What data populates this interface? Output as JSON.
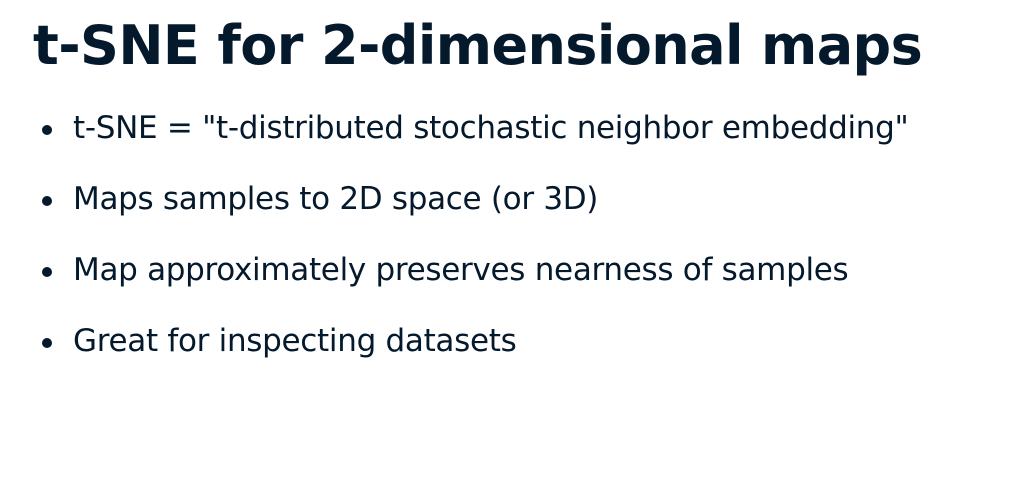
{
  "slide": {
    "title": "t-SNE for 2-dimensional maps",
    "bullets": [
      "t-SNE = \"t-distributed stochastic neighbor embedding\"",
      "Maps samples to 2D space (or 3D)",
      "Map approximately preserves nearness of samples",
      "Great for inspecting datasets"
    ]
  }
}
